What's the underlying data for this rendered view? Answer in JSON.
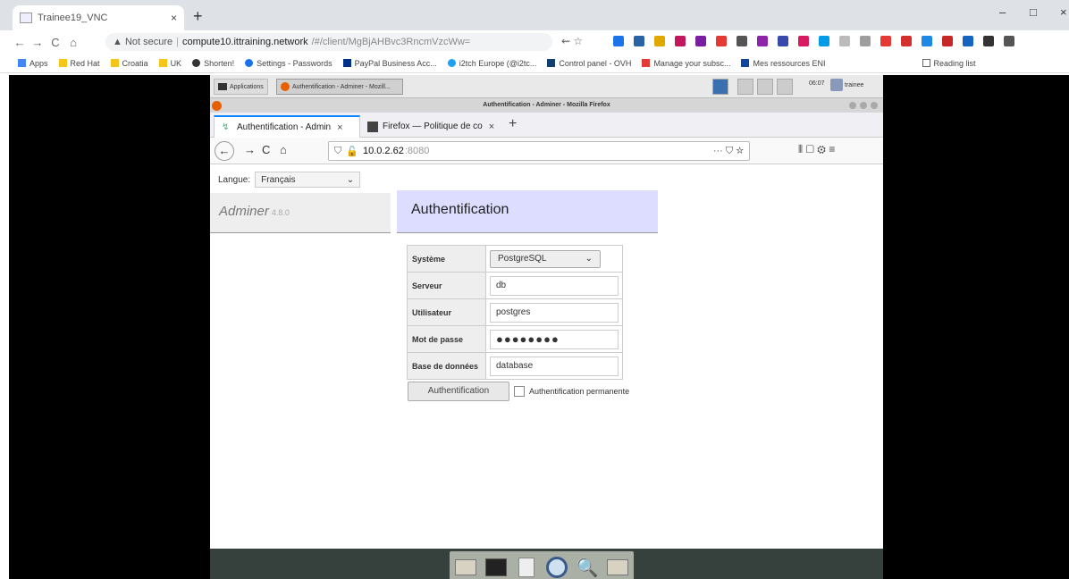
{
  "chrome": {
    "tab_title": "Trainee19_VNC",
    "tab_close": "×",
    "new_tab": "+",
    "win_min": "–",
    "win_max": "□",
    "win_close": "×",
    "nav_back": "←",
    "nav_forward": "→",
    "nav_reload": "C",
    "nav_home": "⌂",
    "security": "▲ Not secure",
    "url_sep": "|",
    "url_host": "compute10.ittraining.network",
    "url_path": "/#/client/MgBjAHBvc3RncmVzcWw=",
    "url_right": "⇜ ☆",
    "bookmarks": [
      "Apps",
      "Red Hat",
      "Croatia",
      "UK",
      "Shorten!",
      "Settings - Passwords",
      "PayPal Business Acc...",
      "i2tch Europe (@i2tc...",
      "Control panel - OVH",
      "Manage your subsc...",
      "Mes ressources ENI"
    ],
    "reading_list": "Reading list",
    "colors": {
      "tabbar": "#dee1e6",
      "accent": "#1a73e8"
    }
  },
  "vnc": {
    "panel": {
      "apps_label": "Applications",
      "task_label": "Authentification - Adminer - Mozill...",
      "clock": "06:07",
      "user": "trainee"
    },
    "firefox": {
      "window_title": "Authentification - Adminer - Mozilla Firefox",
      "tabs": [
        {
          "label": "Authentification - Admin",
          "close": "×"
        },
        {
          "label": "Firefox — Politique de co",
          "close": "×"
        }
      ],
      "new_tab": "+",
      "back": "←",
      "forward": "→",
      "reload": "C",
      "home": "⌂",
      "url_ip": "10.0.2.62",
      "url_port": ":8080",
      "url_actions": "··· ⛉ ☆",
      "toolbar_icons": "⫴ ▢ ⚙ ≡"
    },
    "page": {
      "lang_label": "Langue:",
      "lang_value": "Français",
      "app_name": "Adminer",
      "app_version": "4.8.0",
      "heading": "Authentification",
      "form": [
        {
          "label": "Système",
          "value": "PostgreSQL",
          "type": "select"
        },
        {
          "label": "Serveur",
          "value": "db",
          "type": "text"
        },
        {
          "label": "Utilisateur",
          "value": "postgres",
          "type": "text"
        },
        {
          "label": "Mot de passe",
          "value": "●●●●●●●●",
          "type": "password"
        },
        {
          "label": "Base de données",
          "value": "database",
          "type": "text"
        }
      ],
      "submit_label": "Authentification",
      "permanent_label": "Authentification permanente"
    }
  }
}
